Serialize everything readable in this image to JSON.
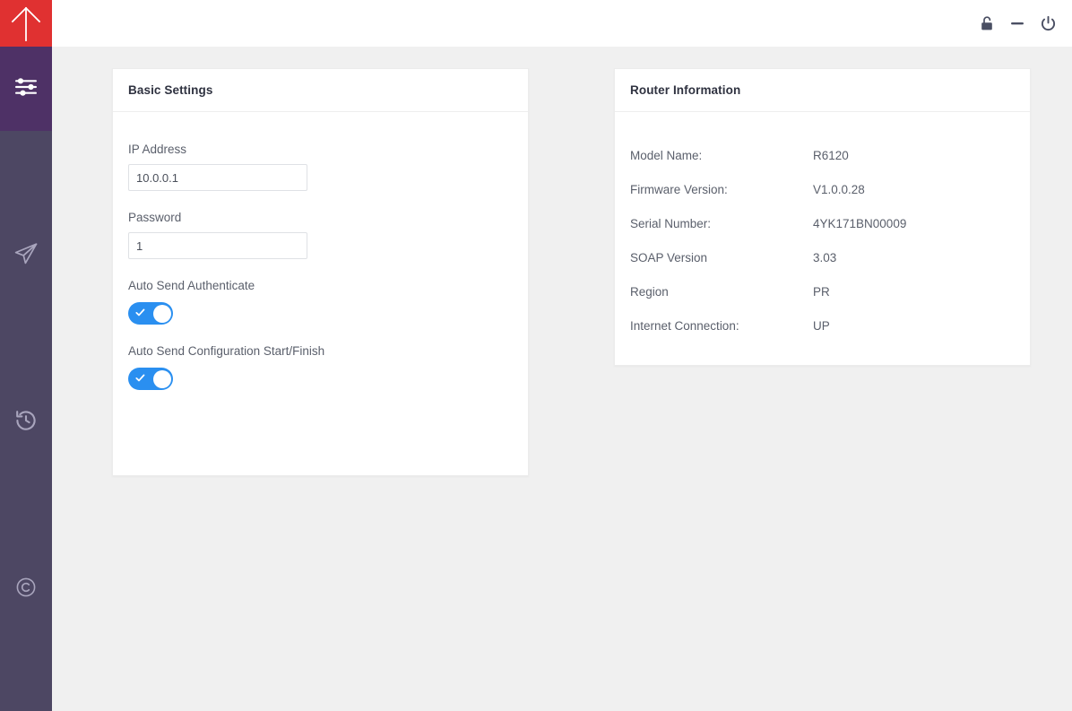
{
  "titlebar": {
    "buttons": [
      {
        "name": "unlock-icon",
        "label": "Unlock"
      },
      {
        "name": "minimize-icon",
        "label": "Minimize"
      },
      {
        "name": "power-icon",
        "label": "Power"
      }
    ]
  },
  "sidebar": {
    "logo": {
      "icon": "up-arrow-icon",
      "label": "Logo",
      "color": "#e03131"
    },
    "background": "#4d4763",
    "active_background": "#4e3166",
    "items": [
      {
        "icon": "sliders-icon",
        "label": "Settings",
        "active": true
      },
      {
        "icon": "send-icon",
        "label": "Send",
        "active": false
      },
      {
        "icon": "history-icon",
        "label": "History",
        "active": false
      },
      {
        "icon": "copyright-icon",
        "label": "About",
        "active": false
      }
    ]
  },
  "basic_settings": {
    "title": "Basic Settings",
    "ip_address": {
      "label": "IP Address",
      "value": "10.0.0.1",
      "placeholder": "IP Address"
    },
    "password": {
      "label": "Password",
      "value": "1",
      "placeholder": "Password"
    },
    "auto_send_authenticate": {
      "label": "Auto Send Authenticate",
      "value": "on"
    },
    "auto_send_configuration": {
      "label": "Auto Send Configuration Start/Finish",
      "value": "on"
    }
  },
  "router_information": {
    "title": "Router Information",
    "rows": [
      {
        "key": "Model Name:",
        "value": "R6120"
      },
      {
        "key": "Firmware Version:",
        "value": "V1.0.0.28"
      },
      {
        "key": "Serial Number:",
        "value": "4YK171BN00009"
      },
      {
        "key": "SOAP Version",
        "value": "3.03"
      },
      {
        "key": "Region",
        "value": "PR"
      },
      {
        "key": "Internet Connection:",
        "value": "UP"
      }
    ]
  },
  "colors": {
    "accent_red": "#e03131",
    "sidebar": "#4d4763",
    "sidebar_active": "#4e3166",
    "toggle_on": "#2a8ff0",
    "page_background": "#f0f0f0"
  }
}
